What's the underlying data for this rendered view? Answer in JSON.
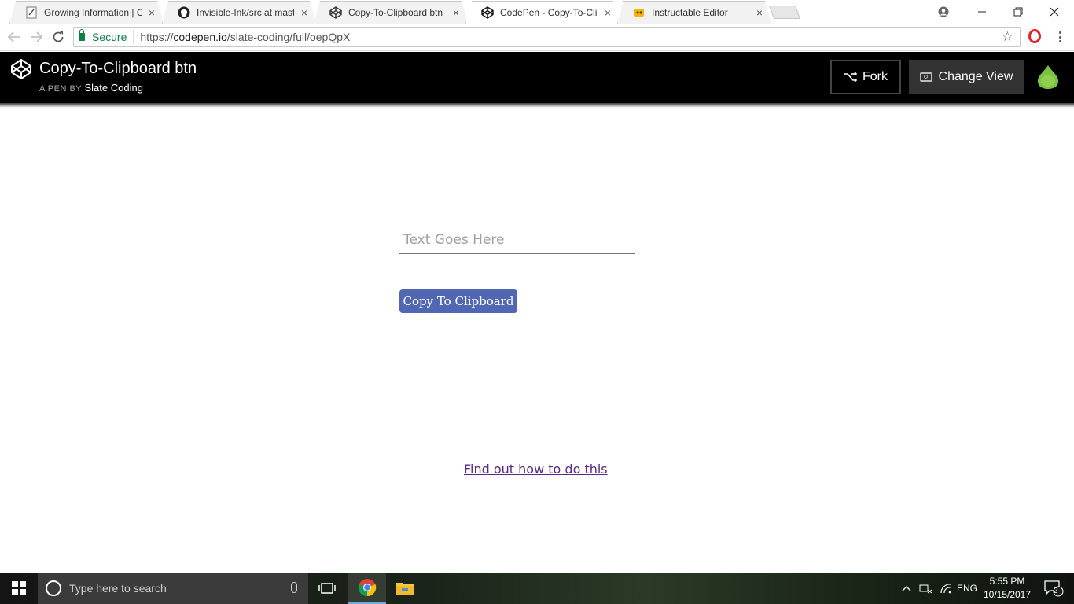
{
  "browser": {
    "tabs": [
      {
        "title": "Growing Information | Cr",
        "icon": "doc-feather-icon",
        "active": false
      },
      {
        "title": "Invisible-Ink/src at maste",
        "icon": "github-icon",
        "active": false
      },
      {
        "title": "Copy-To-Clipboard btn",
        "icon": "codepen-icon",
        "active": false
      },
      {
        "title": "CodePen - Copy-To-Clipb",
        "icon": "codepen-icon",
        "active": true
      },
      {
        "title": "Instructable Editor",
        "icon": "instructables-robot-icon",
        "active": false
      }
    ],
    "address": {
      "secure_label": "Secure",
      "url_scheme": "https://",
      "url_host": "codepen.io",
      "url_path": "/slate-coding/full/oepQpX"
    }
  },
  "codepen": {
    "pen_title": "Copy-To-Clipboard btn",
    "byline_prefix": "A PEN BY",
    "author": "Slate Coding",
    "fork_label": "Fork",
    "change_view_label": "Change View"
  },
  "page": {
    "input_placeholder": "Text Goes Here",
    "input_value": "",
    "copy_button_label": "Copy To Clipboard",
    "howto_link": "Find out how to do this",
    "button_color": "#5167b3",
    "link_color": "#5a2a86"
  },
  "taskbar": {
    "search_placeholder": "Type here to search",
    "language": "ENG",
    "time": "5:55 PM",
    "date": "10/15/2017",
    "notification_count": "2"
  }
}
